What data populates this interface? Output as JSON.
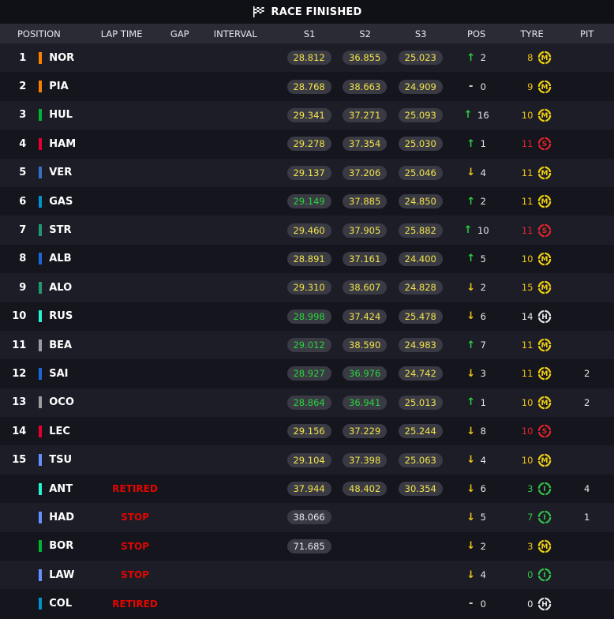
{
  "title": "RACE FINISHED",
  "headers": {
    "position": "POSITION",
    "lap_time": "LAP TIME",
    "gap": "GAP",
    "interval": "INTERVAL",
    "s1": "S1",
    "s2": "S2",
    "s3": "S3",
    "pos": "POS",
    "tyre": "TYRE",
    "pit": "PIT"
  },
  "compound_colors": {
    "M": "#f2d20f",
    "S": "#e0262a",
    "H": "#e8e8e8",
    "I": "#33c247"
  },
  "sector_colors": {
    "yellow": "#f0e34a",
    "green": "#28d43a",
    "white": "#e6e6ea"
  },
  "rows": [
    {
      "pos": "1",
      "color": "#ff8000",
      "driver": "NOR",
      "lap": "",
      "s1": "28.812",
      "s1c": "yellow",
      "s2": "36.855",
      "s2c": "yellow",
      "s3": "25.023",
      "s3c": "yellow",
      "dir": "up",
      "change": "2",
      "tyre_age": "8",
      "age_color": "#f0c419",
      "compound": "M",
      "pit": ""
    },
    {
      "pos": "2",
      "color": "#ff8000",
      "driver": "PIA",
      "lap": "",
      "s1": "28.768",
      "s1c": "yellow",
      "s2": "38.663",
      "s2c": "yellow",
      "s3": "24.909",
      "s3c": "yellow",
      "dir": "same",
      "change": "0",
      "tyre_age": "9",
      "age_color": "#f0c419",
      "compound": "M",
      "pit": ""
    },
    {
      "pos": "3",
      "color": "#00b533",
      "driver": "HUL",
      "lap": "",
      "s1": "29.341",
      "s1c": "yellow",
      "s2": "37.271",
      "s2c": "yellow",
      "s3": "25.093",
      "s3c": "yellow",
      "dir": "up",
      "change": "16",
      "tyre_age": "10",
      "age_color": "#f0c419",
      "compound": "M",
      "pit": ""
    },
    {
      "pos": "4",
      "color": "#e8002d",
      "driver": "HAM",
      "lap": "",
      "s1": "29.278",
      "s1c": "yellow",
      "s2": "37.354",
      "s2c": "yellow",
      "s3": "25.030",
      "s3c": "yellow",
      "dir": "up",
      "change": "1",
      "tyre_age": "11",
      "age_color": "#e0262a",
      "compound": "S",
      "pit": ""
    },
    {
      "pos": "5",
      "color": "#3671c6",
      "driver": "VER",
      "lap": "",
      "s1": "29.137",
      "s1c": "yellow",
      "s2": "37.206",
      "s2c": "yellow",
      "s3": "25.046",
      "s3c": "yellow",
      "dir": "down",
      "change": "4",
      "tyre_age": "11",
      "age_color": "#f0c419",
      "compound": "M",
      "pit": ""
    },
    {
      "pos": "6",
      "color": "#0093cc",
      "driver": "GAS",
      "lap": "",
      "s1": "29.149",
      "s1c": "green",
      "s2": "37.885",
      "s2c": "yellow",
      "s3": "24.850",
      "s3c": "yellow",
      "dir": "up",
      "change": "2",
      "tyre_age": "11",
      "age_color": "#f0c419",
      "compound": "M",
      "pit": ""
    },
    {
      "pos": "7",
      "color": "#229971",
      "driver": "STR",
      "lap": "",
      "s1": "29.460",
      "s1c": "yellow",
      "s2": "37.905",
      "s2c": "yellow",
      "s3": "25.882",
      "s3c": "yellow",
      "dir": "up",
      "change": "10",
      "tyre_age": "11",
      "age_color": "#e0262a",
      "compound": "S",
      "pit": ""
    },
    {
      "pos": "8",
      "color": "#1868db",
      "driver": "ALB",
      "lap": "",
      "s1": "28.891",
      "s1c": "yellow",
      "s2": "37.161",
      "s2c": "yellow",
      "s3": "24.400",
      "s3c": "yellow",
      "dir": "up",
      "change": "5",
      "tyre_age": "10",
      "age_color": "#f0c419",
      "compound": "M",
      "pit": ""
    },
    {
      "pos": "9",
      "color": "#229971",
      "driver": "ALO",
      "lap": "",
      "s1": "29.310",
      "s1c": "yellow",
      "s2": "38.607",
      "s2c": "yellow",
      "s3": "24.828",
      "s3c": "yellow",
      "dir": "down",
      "change": "2",
      "tyre_age": "15",
      "age_color": "#f0c419",
      "compound": "M",
      "pit": ""
    },
    {
      "pos": "10",
      "color": "#27f4d2",
      "driver": "RUS",
      "lap": "",
      "s1": "28.998",
      "s1c": "green",
      "s2": "37.424",
      "s2c": "yellow",
      "s3": "25.478",
      "s3c": "yellow",
      "dir": "down",
      "change": "6",
      "tyre_age": "14",
      "age_color": "#e6e6ea",
      "compound": "H",
      "pit": ""
    },
    {
      "pos": "11",
      "color": "#9c9fa2",
      "driver": "BEA",
      "lap": "",
      "s1": "29.012",
      "s1c": "green",
      "s2": "38.590",
      "s2c": "yellow",
      "s3": "24.983",
      "s3c": "yellow",
      "dir": "up",
      "change": "7",
      "tyre_age": "11",
      "age_color": "#f0c419",
      "compound": "M",
      "pit": ""
    },
    {
      "pos": "12",
      "color": "#1868db",
      "driver": "SAI",
      "lap": "",
      "s1": "28.927",
      "s1c": "green",
      "s2": "36.976",
      "s2c": "green",
      "s3": "24.742",
      "s3c": "yellow",
      "dir": "down",
      "change": "3",
      "tyre_age": "11",
      "age_color": "#f0c419",
      "compound": "M",
      "pit": "2"
    },
    {
      "pos": "13",
      "color": "#9c9fa2",
      "driver": "OCO",
      "lap": "",
      "s1": "28.864",
      "s1c": "green",
      "s2": "36.941",
      "s2c": "green",
      "s3": "25.013",
      "s3c": "yellow",
      "dir": "up",
      "change": "1",
      "tyre_age": "10",
      "age_color": "#f0c419",
      "compound": "M",
      "pit": "2"
    },
    {
      "pos": "14",
      "color": "#e8002d",
      "driver": "LEC",
      "lap": "",
      "s1": "29.156",
      "s1c": "yellow",
      "s2": "37.229",
      "s2c": "yellow",
      "s3": "25.244",
      "s3c": "yellow",
      "dir": "down",
      "change": "8",
      "tyre_age": "10",
      "age_color": "#e0262a",
      "compound": "S",
      "pit": ""
    },
    {
      "pos": "15",
      "color": "#6692ff",
      "driver": "TSU",
      "lap": "",
      "s1": "29.104",
      "s1c": "yellow",
      "s2": "37.398",
      "s2c": "yellow",
      "s3": "25.063",
      "s3c": "yellow",
      "dir": "down",
      "change": "4",
      "tyre_age": "10",
      "age_color": "#f0c419",
      "compound": "M",
      "pit": ""
    },
    {
      "pos": "",
      "color": "#27f4d2",
      "driver": "ANT",
      "lap": "RETIRED",
      "s1": "37.944",
      "s1c": "yellow",
      "s2": "48.402",
      "s2c": "yellow",
      "s3": "30.354",
      "s3c": "yellow",
      "dir": "down",
      "change": "6",
      "tyre_age": "3",
      "age_color": "#33c247",
      "compound": "I",
      "pit": "4"
    },
    {
      "pos": "",
      "color": "#6692ff",
      "driver": "HAD",
      "lap": "STOP",
      "s1": "38.066",
      "s1c": "white",
      "s2": "",
      "s2c": "",
      "s3": "",
      "s3c": "",
      "dir": "down",
      "change": "5",
      "tyre_age": "7",
      "age_color": "#33c247",
      "compound": "I",
      "pit": "1"
    },
    {
      "pos": "",
      "color": "#00b533",
      "driver": "BOR",
      "lap": "STOP",
      "s1": "71.685",
      "s1c": "white",
      "s2": "",
      "s2c": "",
      "s3": "",
      "s3c": "",
      "dir": "down",
      "change": "2",
      "tyre_age": "3",
      "age_color": "#f0c419",
      "compound": "M",
      "pit": ""
    },
    {
      "pos": "",
      "color": "#6692ff",
      "driver": "LAW",
      "lap": "STOP",
      "s1": "",
      "s1c": "",
      "s2": "",
      "s2c": "",
      "s3": "",
      "s3c": "",
      "dir": "down",
      "change": "4",
      "tyre_age": "0",
      "age_color": "#33c247",
      "compound": "I",
      "pit": ""
    },
    {
      "pos": "",
      "color": "#0093cc",
      "driver": "COL",
      "lap": "RETIRED",
      "s1": "",
      "s1c": "",
      "s2": "",
      "s2c": "",
      "s3": "",
      "s3c": "",
      "dir": "same",
      "change": "0",
      "tyre_age": "0",
      "age_color": "#e6e6ea",
      "compound": "H",
      "pit": ""
    }
  ]
}
